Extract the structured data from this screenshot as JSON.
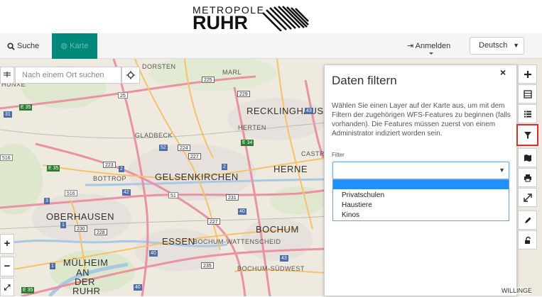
{
  "logo": {
    "line1": "METROPOLE",
    "line2": "RUHR"
  },
  "nav": {
    "search_label": "Suche",
    "map_label": "Karte",
    "login_label": "Anmelden",
    "language": "Deutsch"
  },
  "map_search": {
    "placeholder": "Nach einem Ort suchen"
  },
  "zoom": {
    "in": "+",
    "out": "−"
  },
  "places": {
    "dorsten": "DORSTEN",
    "marl": "MARL",
    "recklinghausen": "RECKLINGHAUSEN",
    "hunxe": "HÜNXE",
    "herten": "HERTEN",
    "gladbeck": "GLADBECK",
    "castrop": "CASTR",
    "bottrop": "BOTTROP",
    "gelsenkirchen": "GELSENKIRCHEN",
    "herne": "HERNE",
    "oberhausen": "OBERHAUSEN",
    "bochum": "BOCHUM",
    "essen": "ESSEN",
    "wattenscheid": "BOCHUM-WATTENSCHEID",
    "muelheim": "MÜLHEIM",
    "an": "AN",
    "der": "DER",
    "ruhr": "RUHR",
    "bochum_sw": "BOCHUM-SÜDWEST",
    "willingen": "WILLINGE"
  },
  "shields": {
    "s225": "225",
    "s25": "25",
    "s31": "31",
    "e35a": "E 35",
    "s229": "229",
    "s43": "43",
    "e34": "E 34",
    "s52": "52",
    "s224": "224",
    "s516": "516",
    "e35b": "E 35",
    "s227": "227",
    "s223": "223",
    "s2a": "2",
    "s2b": "2",
    "s516b": "516",
    "s3": "3",
    "s42": "42",
    "s51": "51",
    "s231": "231",
    "s40": "40",
    "s227b": "227",
    "s230": "230",
    "s228": "228",
    "s1a": "1",
    "s40b": "40",
    "s1": "1",
    "s43b": "43",
    "s235": "235",
    "s40c": "40",
    "e35c": "E 35"
  },
  "filter_panel": {
    "title": "Daten filtern",
    "close": "×",
    "description": "Wählen Sie einen Layer auf der Karte aus, um mit dem Filtern der zugehörigen WFS-Features zu beginnen (falls vorhanden). Die Features müssen zuerst von einem Administrator indiziert worden sein.",
    "filter_label": "Filter",
    "selected_value": "",
    "options": [
      "",
      "Privatschulen",
      "Haustiere",
      "Kinos"
    ]
  },
  "toolbar": {
    "items": [
      "plus-icon",
      "layers-icon",
      "list-icon",
      "filter-icon",
      "map-icon",
      "print-icon",
      "expand-icon",
      "pencil-icon",
      "unlock-icon"
    ],
    "active": "filter-icon"
  },
  "colors": {
    "nav_active": "#00897b",
    "highlight": "#d32f2f",
    "dropdown_selected": "#1e90ff"
  }
}
